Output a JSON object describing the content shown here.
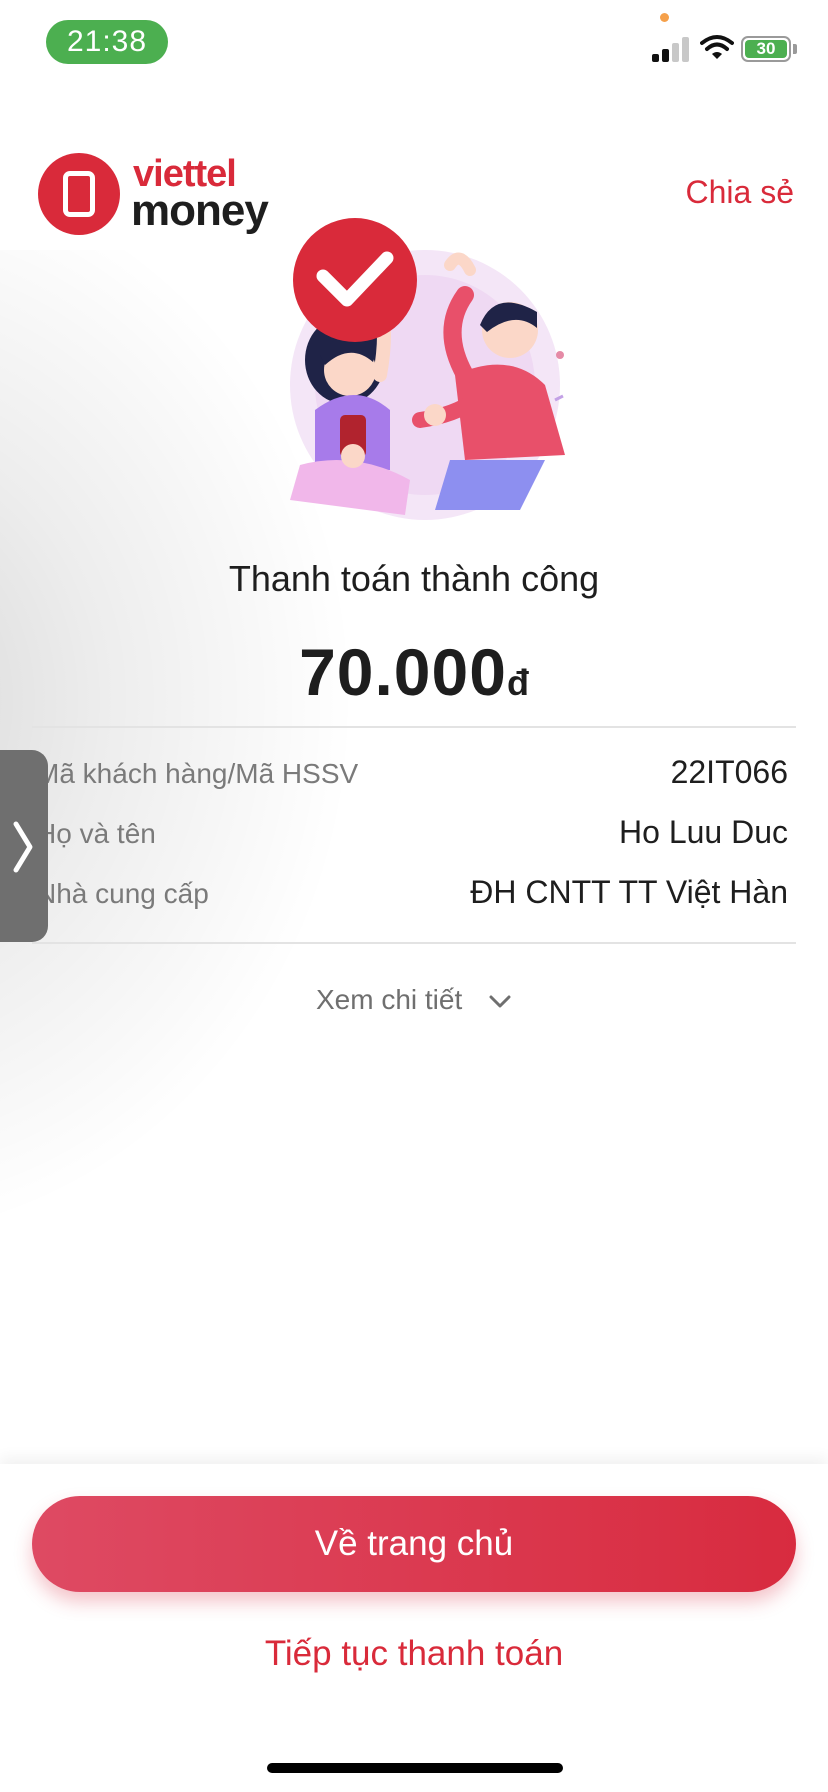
{
  "status_bar": {
    "time": "21:38",
    "battery": "30"
  },
  "header": {
    "logo_line_1": "viettel",
    "logo_line_2": "money",
    "share_label": "Chia sẻ"
  },
  "result": {
    "title": "Thanh toán thành công",
    "amount": "70.000",
    "currency": "đ"
  },
  "details": [
    {
      "label": "Mã khách hàng/Mã HSSV",
      "value": "22IT066"
    },
    {
      "label": "Họ và tên",
      "value": "Ho Luu Duc"
    },
    {
      "label": "Nhà cung cấp",
      "value": "ĐH CNTT TT Việt Hàn"
    }
  ],
  "view_details_label": "Xem chi tiết",
  "actions": {
    "home_label": "Về trang chủ",
    "continue_label": "Tiếp tục thanh toán"
  },
  "colors": {
    "brand_red": "#d92a3a",
    "status_green": "#4caf50"
  }
}
